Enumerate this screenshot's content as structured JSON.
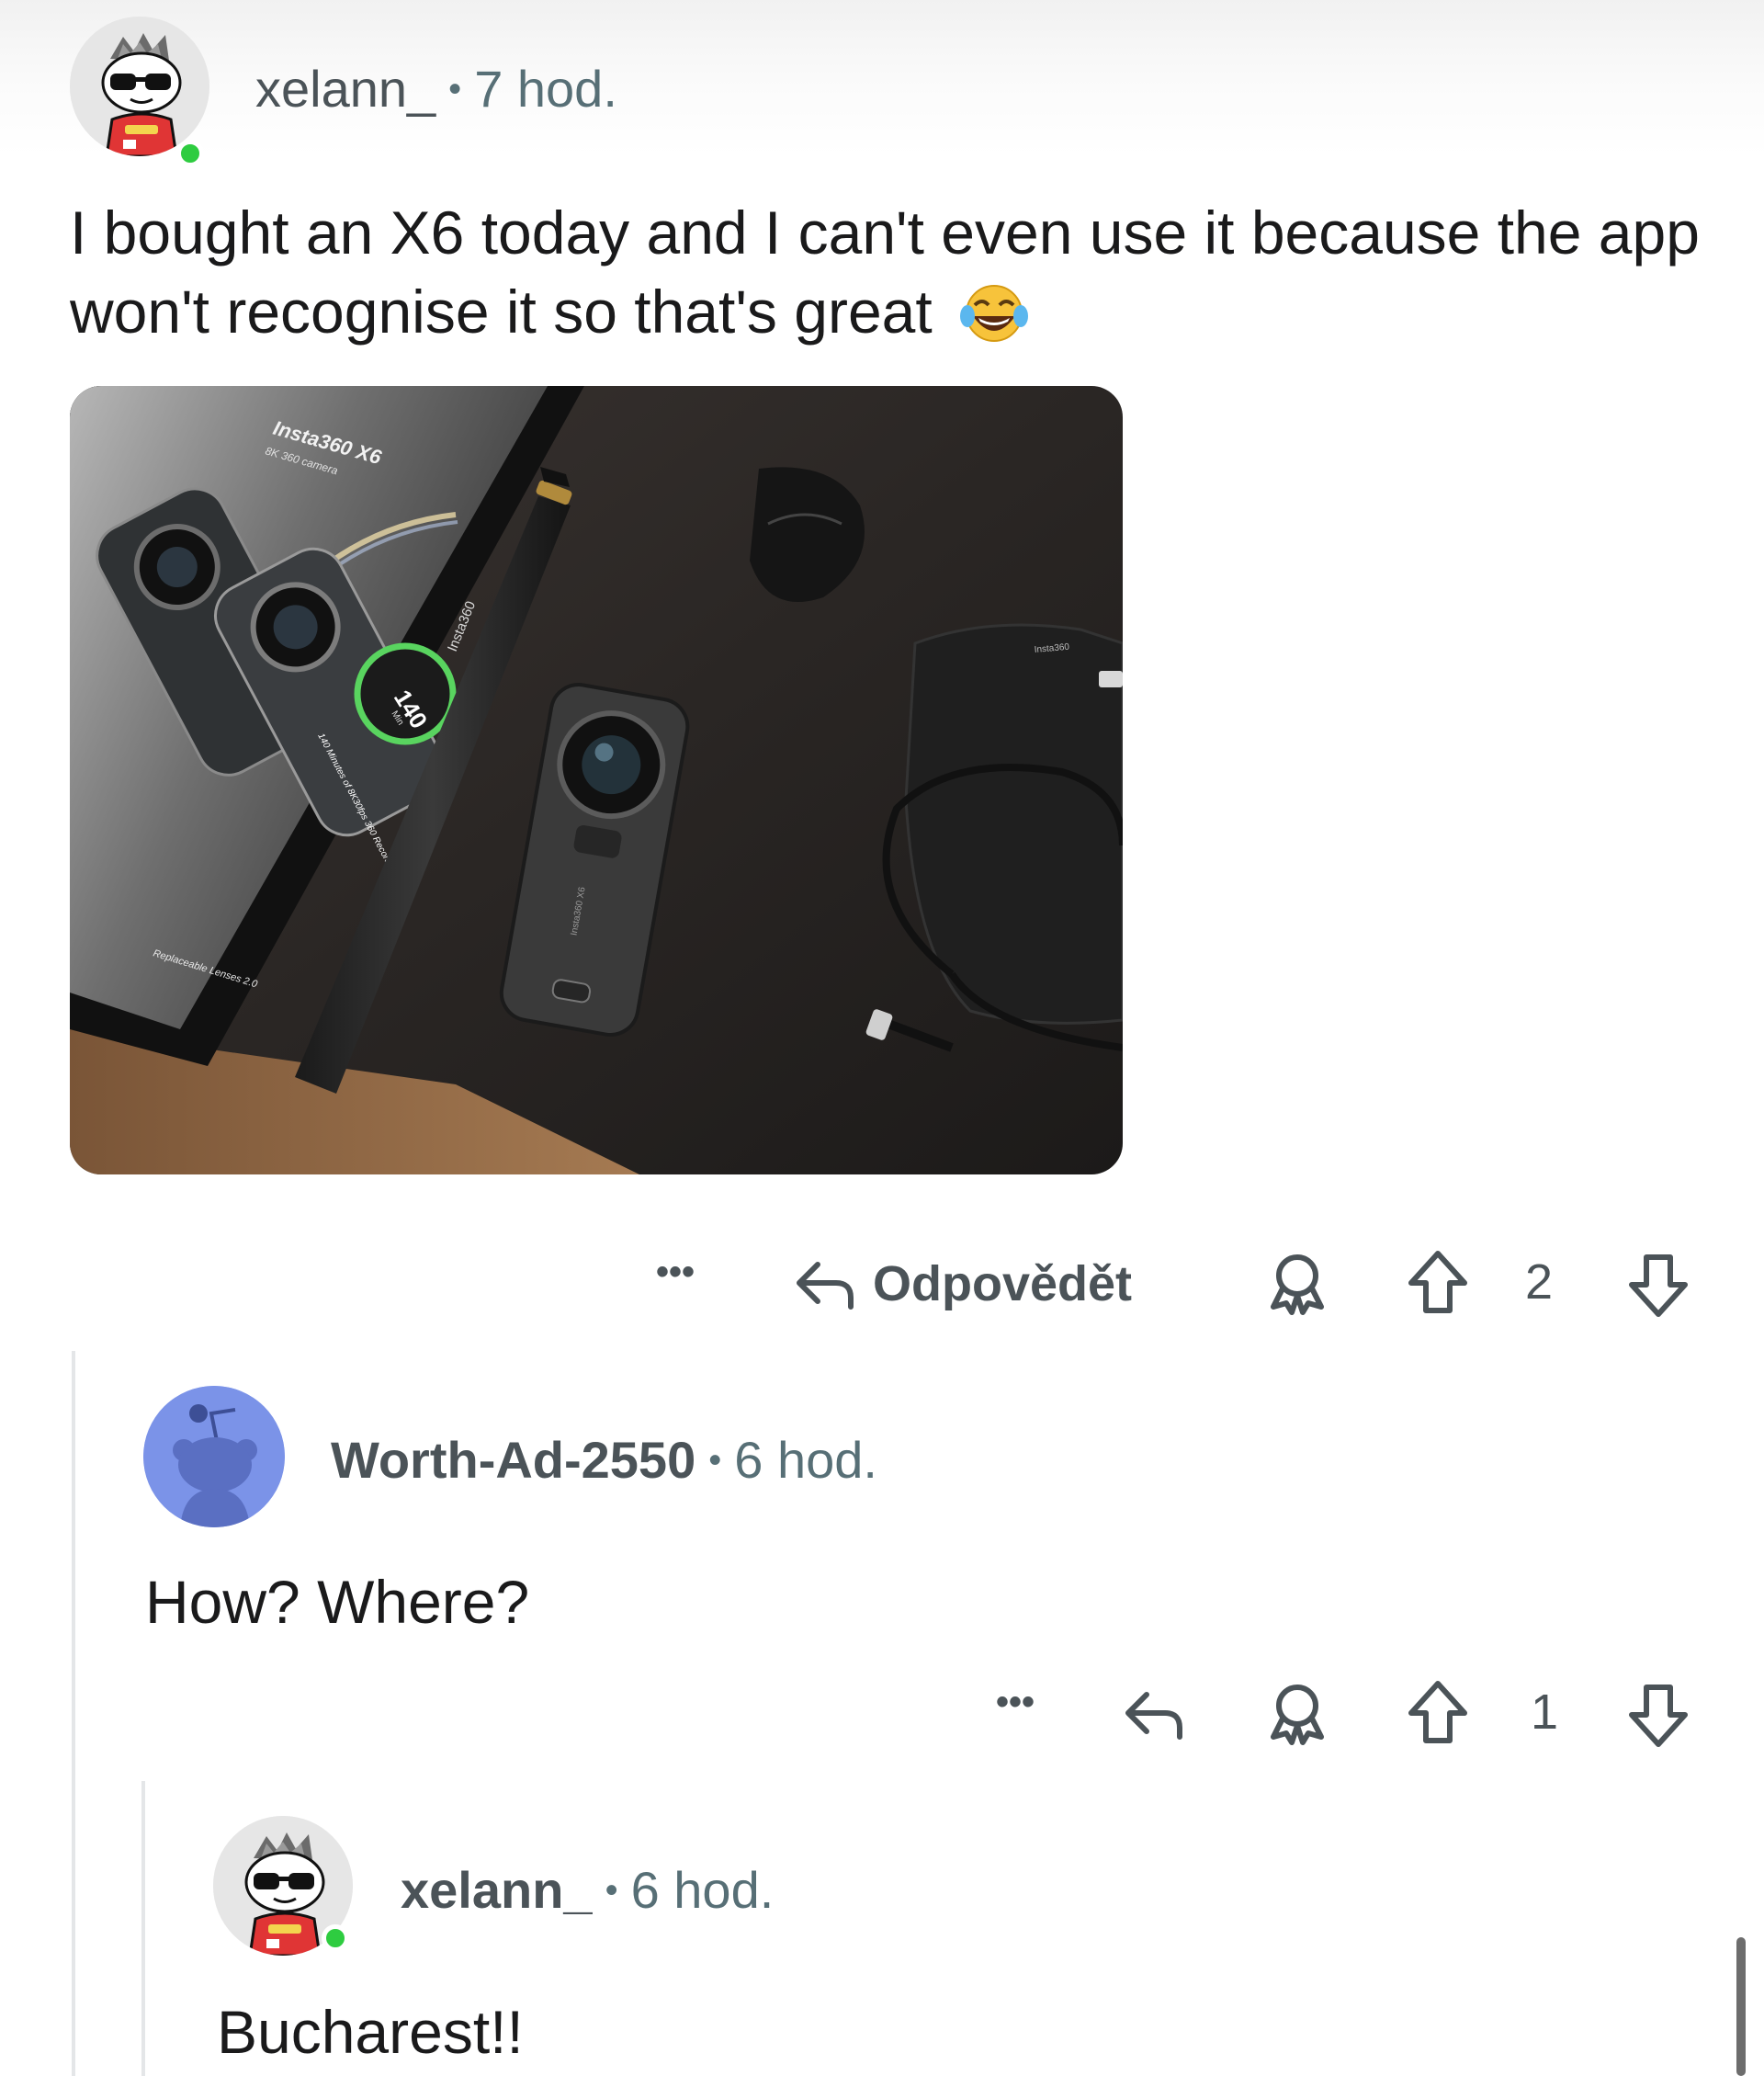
{
  "comment1": {
    "username": "xelann_",
    "separator": "•",
    "time": "7 hod.",
    "text": "I bought an X6 today and I can't even use it because the app won't recognise it so that's great",
    "emoji": "😂",
    "image": {
      "box_title": "Insta360 X6",
      "box_subtitle": "8K 360 camera",
      "stick_brand": "Insta360",
      "minutes": "140",
      "minutes_unit": "Min",
      "box_caption_1": "140 Minutes of 8K30fps 360 Recording",
      "box_caption_2": "Replaceable Lenses 2.0",
      "pouch_brand": "Insta360",
      "camera_label": "Insta360 X6"
    },
    "actions": {
      "more": "•••",
      "reply_label": "Odpovědět",
      "score": "2"
    }
  },
  "comment2": {
    "username": "Worth-Ad-2550",
    "separator": "•",
    "time": "6 hod.",
    "text": "How? Where?",
    "actions": {
      "more": "•••",
      "score": "1"
    }
  },
  "comment3": {
    "username": "xelann_",
    "separator": "•",
    "time": "6 hod.",
    "text": "Bucharest!!"
  },
  "colors": {
    "online": "#2ecc40",
    "avatar_blue": "#7b93e8",
    "meta_gray": "#576f76",
    "thread_line": "#e4e6e8"
  }
}
